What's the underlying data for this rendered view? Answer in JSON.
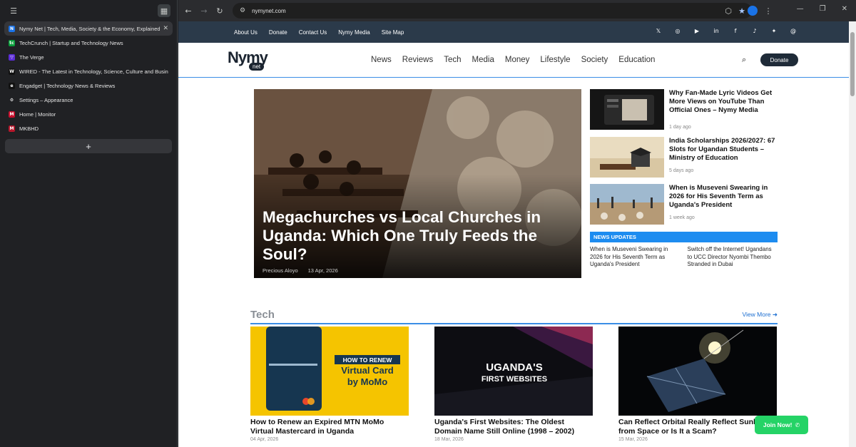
{
  "sidebar": {
    "tabs": [
      {
        "title": "Nymy Net | Tech, Media, Society & the Economy, Explained",
        "icon": "nymy-favicon",
        "active": true
      },
      {
        "title": "TechCrunch | Startup and Technology News",
        "icon": "techcrunch-favicon"
      },
      {
        "title": "The Verge",
        "icon": "verge-favicon"
      },
      {
        "title": "WIRED - The Latest in Technology, Science, Culture and Busine",
        "icon": "wired-favicon"
      },
      {
        "title": "Engadget | Technology News & Reviews",
        "icon": "engadget-favicon"
      },
      {
        "title": "Settings – Appearance",
        "icon": "settings-gear-icon"
      },
      {
        "title": "Home | Monitor",
        "icon": "monitor-favicon"
      },
      {
        "title": "MKBHD",
        "icon": "mkbhd-favicon"
      }
    ],
    "new_tab": "+"
  },
  "toolbar": {
    "url": "nymynet.com"
  },
  "site": {
    "top_links": [
      "About Us",
      "Donate",
      "Contact Us",
      "Nymy Media",
      "Site Map"
    ],
    "social": [
      "x-icon",
      "instagram-icon",
      "youtube-icon",
      "linkedin-icon",
      "facebook-icon",
      "tiktok-icon",
      "bluesky-icon",
      "threads-icon"
    ],
    "logo_word": "Nymy",
    "logo_sub": "net",
    "menu": [
      "News",
      "Reviews",
      "Tech",
      "Media",
      "Money",
      "Lifestyle",
      "Society",
      "Education"
    ],
    "donate": "Donate"
  },
  "hero": {
    "title": "Megachurches vs Local Churches in Uganda: Which One Truly Feeds the Soul?",
    "author": "Precious Aloyo",
    "date": "13 Apr, 2026"
  },
  "side_stories": [
    {
      "title": "Why Fan-Made Lyric Videos Get More Views on YouTube Than Official Ones – Nymy Media",
      "time": "1 day ago"
    },
    {
      "title": "India Scholarships 2026/2027: 67 Slots for Ugandan Students – Ministry of Education",
      "time": "5 days ago"
    },
    {
      "title": "When is Museveni Swearing in 2026 for His Seventh Term as Uganda's President",
      "time": "1 week ago"
    }
  ],
  "news_updates": {
    "label": "NEWS UPDATES",
    "items": [
      "When is Museveni Swearing in 2026 for His Seventh Term as Uganda's President",
      "Switch off the Internet! Ugandans to UCC Director Nyombi Thembo Stranded in Dubai"
    ]
  },
  "tech": {
    "title": "Tech",
    "more": "View More",
    "cards": [
      {
        "title": "How to Renew an Expired MTN MoMo Virtual Mastercard in Uganda",
        "date": "04 Apr, 2026",
        "img_line1": "HOW TO RENEW",
        "img_line2": "Virtual Card",
        "img_line3": "by MoMo"
      },
      {
        "title": "Uganda's First Websites: The Oldest Domain Name Still Online (1998 – 2002)",
        "date": "18 Mar, 2026",
        "img_line1": "UGANDA'S",
        "img_line2": "FIRST WEBSITES"
      },
      {
        "title": "Can Reflect Orbital Really Reflect Sunlight from Space or Is It a Scam?",
        "date": "15 Mar, 2026"
      }
    ]
  },
  "join": "Join Now!"
}
